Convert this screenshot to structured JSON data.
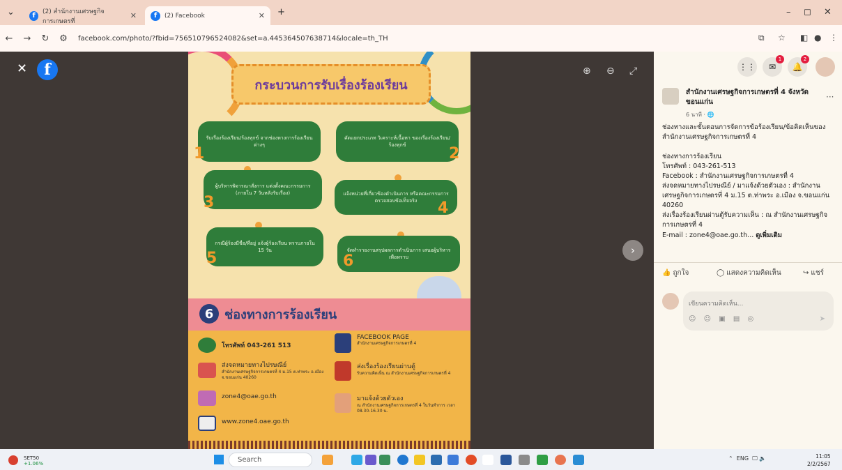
{
  "browser": {
    "tabs": [
      {
        "label": "(2) สำนักงานเศรษฐกิจการเกษตรที่"
      },
      {
        "label": "(2) Facebook"
      }
    ],
    "new_tab": "+",
    "url": "facebook.com/photo/?fbid=756510796524082&set=a.445364507638714&locale=th_TH",
    "window_controls": {
      "minimize": "–",
      "maximize": "◻",
      "close": "✕"
    }
  },
  "viewer": {
    "close": "✕",
    "logo": "f",
    "zoom_in": "⊕",
    "zoom_out": "⊖",
    "fullscreen": "⤢",
    "next": "›"
  },
  "poster": {
    "title": "กระบวนการรับเรื่องร้องเรียน",
    "steps": [
      {
        "num": "1",
        "text": "รับเรื่องร้องเรียน/ร้องทุกข์ จากช่องทางการร้องเรียนต่างๆ"
      },
      {
        "num": "2",
        "text": "คัดแยกประเภท วิเคราะห์เนื้อหา ของเรื่องร้องเรียน/ร้องทุกข์"
      },
      {
        "num": "3",
        "text": "ผู้บริหารพิจารณาสั่งการ แต่งตั้งคณะกรรมการ (ภายใน 7 วันหลังรับเรื่อง)"
      },
      {
        "num": "4",
        "text": "แจ้งหน่วยที่เกี่ยวข้องดำเนินการ หรือคณะกรรมการ ตรวจสอบข้อเท็จจริง"
      },
      {
        "num": "5",
        "text": "กรณีผู้ร้องมีชื่อ/ที่อยู่ แจ้งผู้ร้องเรียน ทราบภายใน 15 วัน"
      },
      {
        "num": "6",
        "text": "จัดทำรายงานสรุปผลการดำเนินการ เสนอผู้บริหาร เพื่อทราบ"
      }
    ],
    "channels_num": "6",
    "channels_title": "ช่องทางการร้องเรียน",
    "channels": [
      {
        "label": "โทรศัพท์ 043-261 513",
        "sub": ""
      },
      {
        "label": "FACEBOOK PAGE",
        "sub": "สำนักงานเศรษฐกิจการเกษตรที่ 4"
      },
      {
        "label": "ส่งจดหมายทางไปรษณีย์",
        "sub": "สำนักงานเศรษฐกิจการเกษตรที่ 4 ม.15 ต.ท่าพระ อ.เมือง จ.ขอนแก่น 40260"
      },
      {
        "label": "ส่งเรื่องร้องเรียนผ่านตู้",
        "sub": "รับความคิดเห็น ณ สำนักงานเศรษฐกิจการเกษตรที่ 4"
      },
      {
        "label": "zone4@oae.go.th",
        "sub": ""
      },
      {
        "label": "มาแจ้งด้วยตัวเอง",
        "sub": "ณ สำนักงานเศรษฐกิจการเกษตรที่ 4 ในวันทำการ เวลา 08.30-16.30 น."
      },
      {
        "label": "www.zone4.oae.go.th",
        "sub": ""
      }
    ]
  },
  "panel": {
    "top_icons": {
      "menu": "⋮⋮",
      "messenger_badge": "1",
      "notif_badge": "2"
    },
    "page_name": "สำนักงานเศรษฐกิจการเกษตรที่ 4 จังหวัดขอนแก่น",
    "post_time": "6 นาที · 🌐",
    "more": "···",
    "post_text": "ช่องทางและขั้นตอนการจัดการข้อร้องเรียน/ข้อคิดเห็นของสำนักงานเศรษฐกิจการเกษตรที่ 4\n\nช่องทางการร้องเรียน\nโทรศัพท์ : 043-261-513\nFacebook : สำนักงานเศรษฐกิจการเกษตรที่ 4\nส่งจดหมายทางไปรษณีย์ / มาแจ้งด้วยตัวเอง : สำนักงานเศรษฐกิจการเกษตรที่ 4 ม.15 ต.ท่าพระ อ.เมือง จ.ขอนแก่น 40260\nส่งเรื่องร้องเรียนผ่านตู้รับความเห็น : ณ สำนักงานเศรษฐกิจการเกษตรที่ 4\nE-mail : zone4@oae.go.th... ",
    "see_more": "ดูเพิ่มเติม",
    "actions": {
      "like": "ถูกใจ",
      "comment": "แสดงความคิดเห็น",
      "share": "แชร์"
    },
    "comment_placeholder": "เขียนความคิดเห็น..."
  },
  "taskbar": {
    "weather_title": "SET50",
    "weather_value": "+1.06%",
    "search": "Search",
    "tray": "ENG",
    "time": "11:05",
    "date": "2/2/2567"
  },
  "colors": {
    "poster_bg": "#f6e2ad",
    "step_green": "#2f7d3a",
    "title_purple": "#6c3b9c",
    "fb_blue": "#1877f2"
  }
}
